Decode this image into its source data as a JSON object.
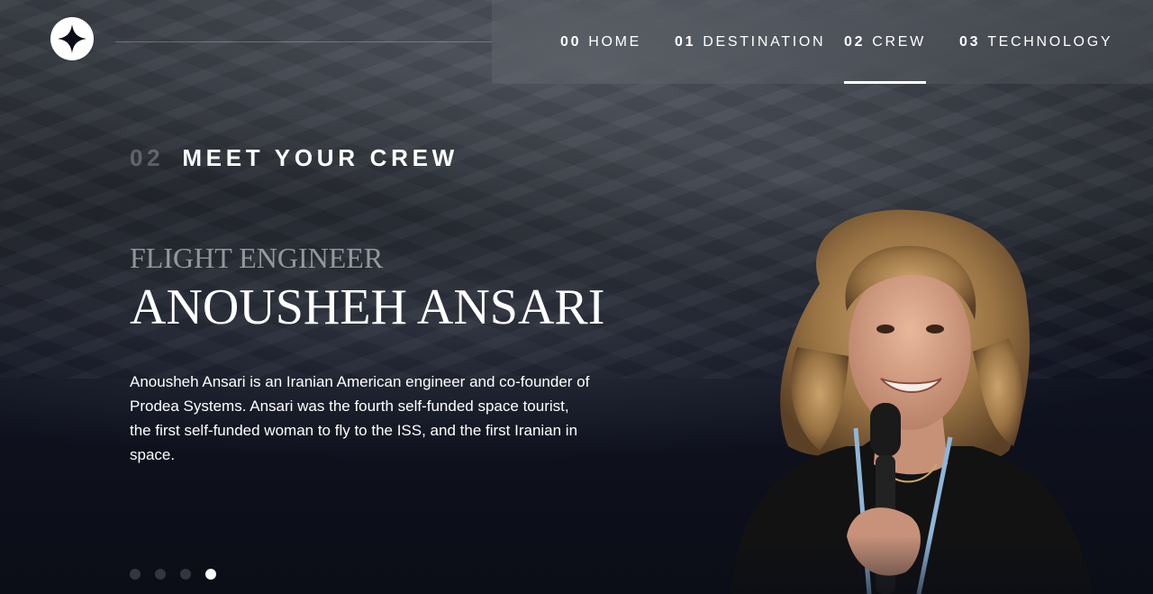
{
  "nav": {
    "items": [
      {
        "num": "00",
        "label": "HOME"
      },
      {
        "num": "01",
        "label": "DESTINATION"
      },
      {
        "num": "02",
        "label": "CREW"
      },
      {
        "num": "03",
        "label": "TECHNOLOGY"
      }
    ],
    "active_index": 2
  },
  "page_heading": {
    "num": "02",
    "title": "MEET YOUR CREW"
  },
  "crew": {
    "role": "FLIGHT ENGINEER",
    "name": "ANOUSHEH ANSARI",
    "bio": "Anousheh Ansari is an Iranian American engineer and co-founder of Prodea Systems. Ansari was the fourth self-funded space tourist, the first self-funded woman to fly to the ISS, and the first Iranian in space."
  },
  "carousel": {
    "total": 4,
    "active_index": 3
  },
  "colors": {
    "background": "#0b0d17",
    "text": "#ffffff",
    "accent": "#ffffff"
  },
  "icons": {
    "logo": "four-point-star-icon"
  }
}
